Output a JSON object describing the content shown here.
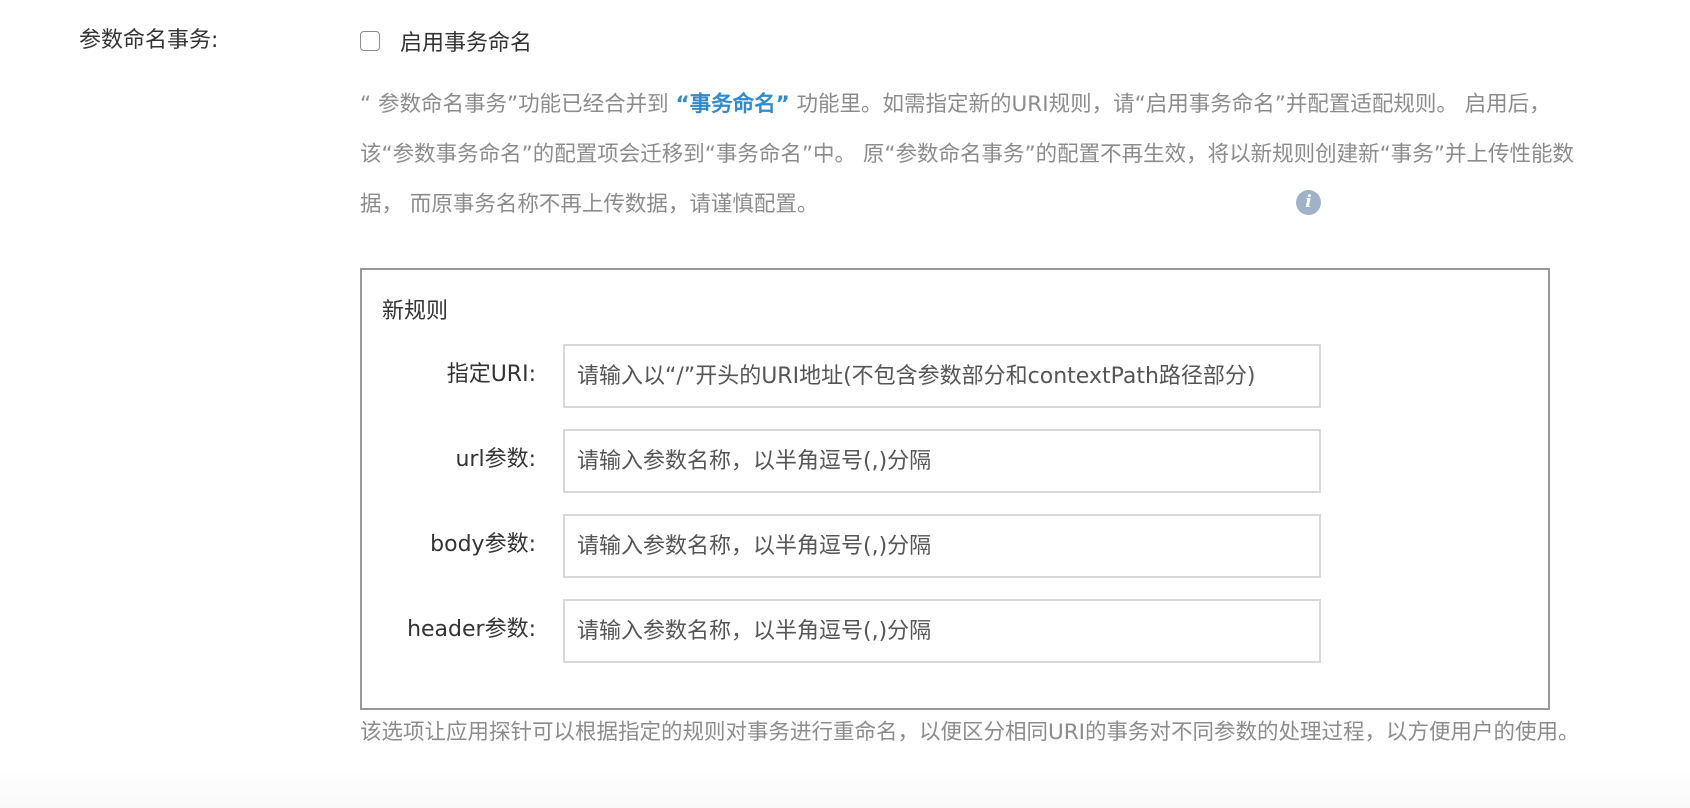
{
  "field": {
    "label": "参数命名事务:"
  },
  "enable_checkbox": {
    "label": "启用事务命名",
    "checked": false
  },
  "description": {
    "part1": "“ 参数命名事务”功能已经合并到 ",
    "highlight": "“事务命名”",
    "part2": " 功能里。如需指定新的URI规则，请“启用事务命名”并配置适配规则。 启用后，该“参数事务命名”的配置项会迁移到“事务命名”中。 原“参数命名事务”的配置不再生效，将以新规则创建新“事务”并上传性能数据， 而原事务名称不再上传数据，请谨慎配置。",
    "highlight_color": "#2e8bd1"
  },
  "info_icon": {
    "glyph": "i",
    "icon": "info-icon"
  },
  "new_rule": {
    "title": "新规则",
    "rows": [
      {
        "label": "指定URI:",
        "placeholder": "请输入以“/”开头的URI地址(不包含参数部分和contextPath路径部分)",
        "value": ""
      },
      {
        "label": "url参数:",
        "placeholder": "请输入参数名称，以半角逗号(,)分隔",
        "value": ""
      },
      {
        "label": "body参数:",
        "placeholder": "请输入参数名称，以半角逗号(,)分隔",
        "value": ""
      },
      {
        "label": "header参数:",
        "placeholder": "请输入参数名称，以半角逗号(,)分隔",
        "value": ""
      }
    ]
  },
  "footer": {
    "text": "该选项让应用探针可以根据指定的规则对事务进行重命名，以便区分相同URI的事务对不同参数的处理过程，以方便用户的使用。"
  }
}
